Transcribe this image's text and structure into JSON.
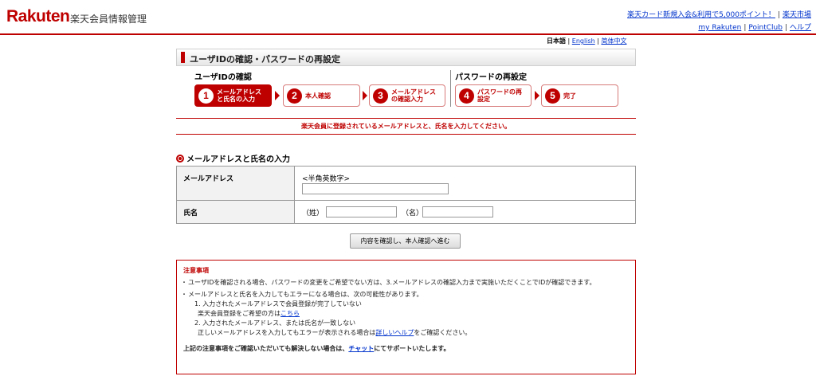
{
  "header": {
    "logo": "Rakuten",
    "logo_sub": "楽天会員情報管理",
    "top_link1": "楽天カード新規入会&利用で5,000ポイント！",
    "top_link2": "楽天市場",
    "link_myrakuten": "my Rakuten",
    "link_pointclub": "PointClub",
    "link_help": "ヘルプ",
    "separator": "|"
  },
  "lang": {
    "current": "日本語",
    "english": "English",
    "chinese": "简体中文",
    "separator": "|"
  },
  "page_title": "ユーザIDの確認・パスワードの再設定",
  "steps": {
    "group1": "ユーザIDの確認",
    "group2": "パスワードの再設定",
    "items": [
      {
        "num": "1",
        "label": "メールアドレス\nと氏名の入力"
      },
      {
        "num": "2",
        "label": "本人確認"
      },
      {
        "num": "3",
        "label": "メールアドレス\nの確認入力"
      },
      {
        "num": "4",
        "label": "パスワードの再\n設定"
      },
      {
        "num": "5",
        "label": "完了"
      }
    ]
  },
  "notice": "楽天会員に登録されているメールアドレスと、氏名を入力してください。",
  "section_heading": "メールアドレスと氏名の入力",
  "form": {
    "email_label": "メールアドレス",
    "email_hint": "<半角英数字>",
    "email_value": "",
    "name_label": "氏名",
    "last_label": "（姓）",
    "first_label": "（名）",
    "last_value": "",
    "first_value": "",
    "submit": "内容を確認し、本人確認へ進む"
  },
  "caution": {
    "title": "注意事項",
    "b1": "ユーザIDを確認される場合、パスワードの変更をご希望でない方は、3.メールアドレスの確認入力まで実施いただくことでIDが確認できます。",
    "b2": "メールアドレスと氏名を入力してもエラーになる場合は、次の可能性があります。",
    "l1": "1. 入力されたメールアドレスで会員登録が完了していない",
    "l1b_pre": "楽天会員登録をご希望の方は",
    "l1b_link": "こちら",
    "l2": "2. 入力されたメールアドレス、または氏名が一致しない",
    "l2b_pre": "正しいメールアドレスを入力してもエラーが表示される場合は",
    "l2b_link": "詳しいヘルプ",
    "l2b_post": "をご確認ください。",
    "foot_pre": "上記の注意事項をご確認いただいても解決しない場合は、",
    "foot_link": "チャット",
    "foot_post": "にてサポートいたします。"
  },
  "colors": {
    "brand": "#bf0000",
    "link": "#0033cc"
  }
}
